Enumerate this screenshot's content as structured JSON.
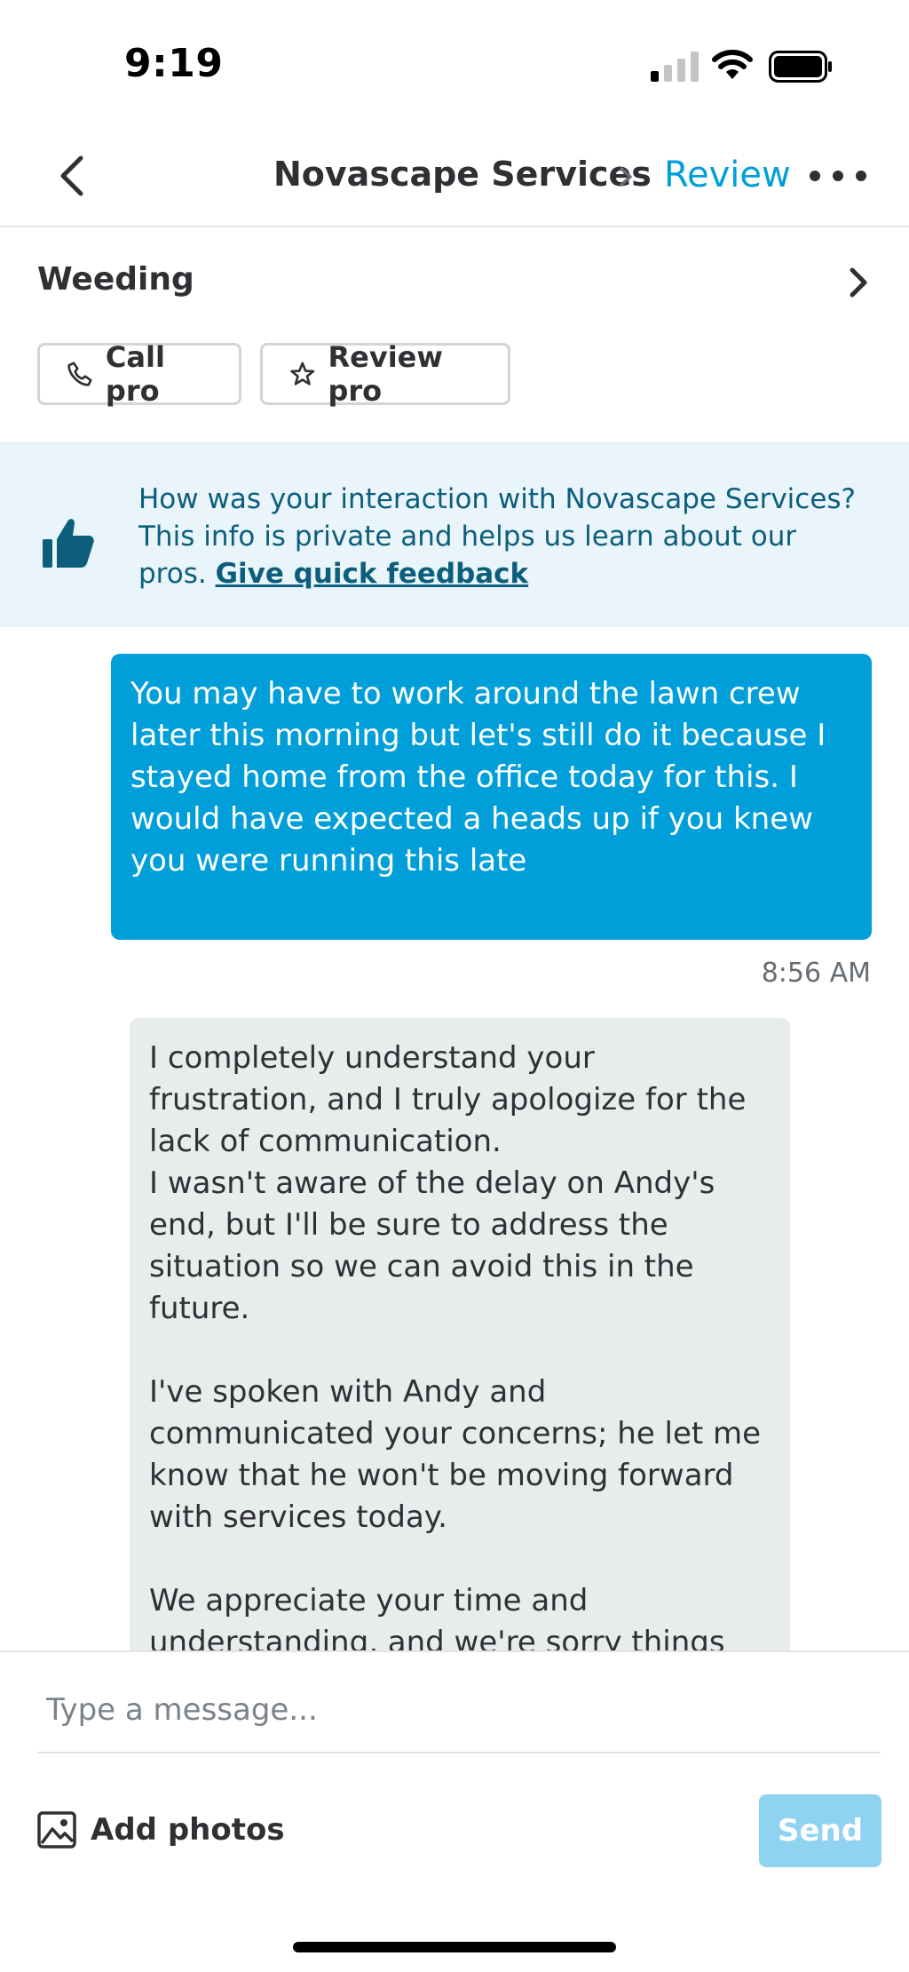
{
  "status_bar": {
    "time": "9:19"
  },
  "nav": {
    "title": "Novascape Services",
    "review_label": "Review",
    "icons": [
      "chevron-left-icon",
      "chevron-right-icon",
      "more-icon"
    ]
  },
  "job": {
    "title": "Weeding",
    "call_label": "Call pro",
    "review_label": "Review pro"
  },
  "feedback": {
    "text": "How was your interaction with Novascape Services? This info is private and helps us learn about our pros. ",
    "link": "Give quick feedback"
  },
  "messages": [
    {
      "direction": "outgoing",
      "text": "You may have to work around the lawn crew later this morning but let's still do it because I stayed home from the office today for this. I would have expected a heads up if you knew you were running this late",
      "time": "8:56 AM"
    },
    {
      "direction": "incoming",
      "text": "I completely understand your frustration, and I truly apologize for the lack of communication.\nI wasn't aware of the delay on Andy's end, but I'll be sure to address the situation so we can avoid this in the future.\n\nI've spoken with Andy and communicated your concerns; he let me know that he won't be moving forward with services today.\n\nWe appreciate your time and understanding, and we're sorry things"
    }
  ],
  "composer": {
    "placeholder": "Type a message...",
    "add_photos_label": "Add photos",
    "send_label": "Send"
  },
  "colors": {
    "accent": "#009fd9",
    "send_disabled": "#8fd3f1",
    "banner_bg": "#e9f5fa",
    "banner_text": "#0c5e7c",
    "incoming_bubble": "#e9eced"
  }
}
